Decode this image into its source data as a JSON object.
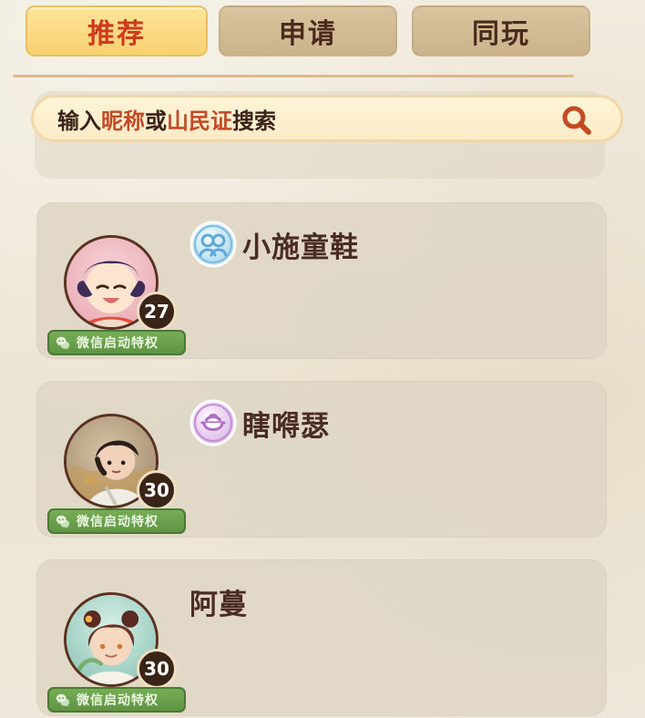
{
  "tabs": [
    {
      "label": "推荐",
      "active": true
    },
    {
      "label": "申请",
      "active": false
    },
    {
      "label": "同玩",
      "active": false
    }
  ],
  "search": {
    "prefix": "输入",
    "highlight1": "昵称",
    "middle": "或",
    "highlight2": "山民证",
    "suffix": "搜索",
    "icon": "search-icon"
  },
  "users": [
    {
      "name": "小施童鞋",
      "level": "27",
      "badge": "couple-badge-icon",
      "wechat_privilege": "微信启动特权"
    },
    {
      "name": "瞎嘚瑟",
      "level": "30",
      "badge": "bowl-badge-icon",
      "wechat_privilege": "微信启动特权"
    },
    {
      "name": "阿蔓",
      "level": "30",
      "badge": "",
      "wechat_privilege": "微信启动特权"
    }
  ],
  "colors": {
    "active_tab_bg": "#f7d070",
    "active_tab_text": "#cf3b1f",
    "inactive_tab_bg": "#cbb48b",
    "wechat_green": "#5e9443",
    "name_text": "#4a2c22"
  }
}
